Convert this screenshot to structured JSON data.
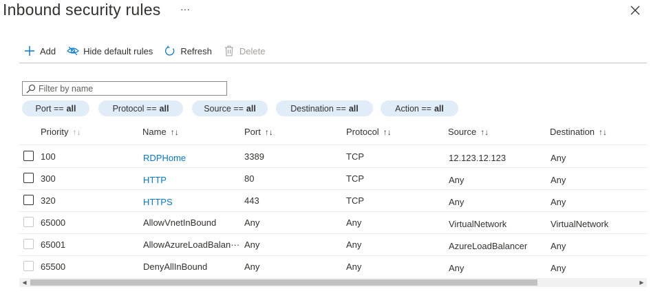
{
  "header": {
    "title": "Inbound security rules",
    "more_label": "···",
    "close_icon": "close-icon"
  },
  "toolbar": {
    "add_label": "Add",
    "hide_default_label": "Hide default rules",
    "refresh_label": "Refresh",
    "delete_label": "Delete"
  },
  "filter": {
    "placeholder": "Filter by name",
    "value": ""
  },
  "pills": [
    {
      "label": "Port ==",
      "value": "all"
    },
    {
      "label": "Protocol ==",
      "value": "all"
    },
    {
      "label": "Source ==",
      "value": "all"
    },
    {
      "label": "Destination ==",
      "value": "all"
    },
    {
      "label": "Action ==",
      "value": "all"
    }
  ],
  "table": {
    "columns": [
      "Priority",
      "Name",
      "Port",
      "Protocol",
      "Source",
      "Destination"
    ],
    "sort_icon": "↑↓",
    "rows": [
      {
        "priority": "100",
        "name": "RDPHome",
        "port": "3389",
        "protocol": "TCP",
        "source": "12.123.12.123",
        "destination": "Any",
        "custom": true
      },
      {
        "priority": "300",
        "name": "HTTP",
        "port": "80",
        "protocol": "TCP",
        "source": "Any",
        "destination": "Any",
        "custom": true
      },
      {
        "priority": "320",
        "name": "HTTPS",
        "port": "443",
        "protocol": "TCP",
        "source": "Any",
        "destination": "Any",
        "custom": true
      },
      {
        "priority": "65000",
        "name": "AllowVnetInBound",
        "port": "Any",
        "protocol": "Any",
        "source": "VirtualNetwork",
        "destination": "VirtualNetwork",
        "custom": false
      },
      {
        "priority": "65001",
        "name": "AllowAzureLoadBalan···",
        "port": "Any",
        "protocol": "Any",
        "source": "AzureLoadBalancer",
        "destination": "Any",
        "custom": false
      },
      {
        "priority": "65500",
        "name": "DenyAllInBound",
        "port": "Any",
        "protocol": "Any",
        "source": "Any",
        "destination": "Any",
        "custom": false
      }
    ]
  },
  "colors": {
    "link": "#0078d4",
    "pill_bg": "#e0ecf8",
    "accent": "#0078d4"
  }
}
